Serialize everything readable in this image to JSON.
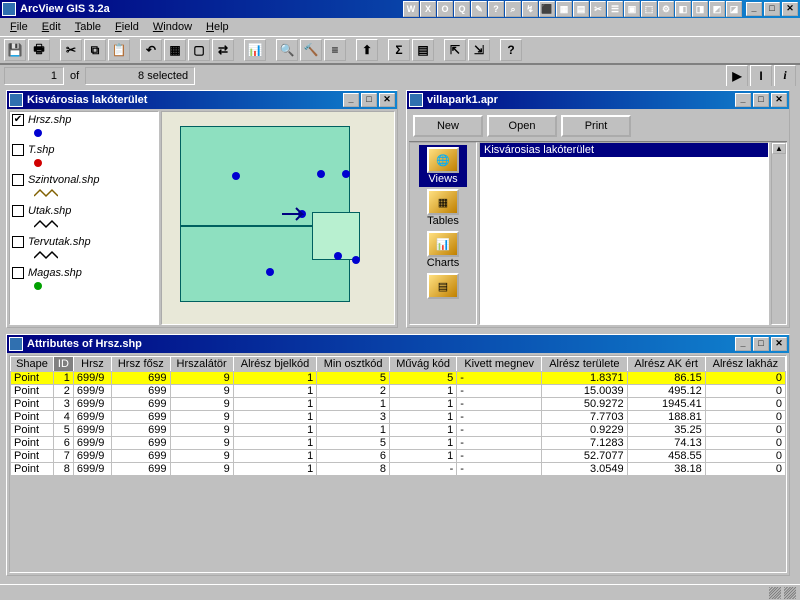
{
  "app": {
    "title": "ArcView GIS 3.2a"
  },
  "menu": [
    "File",
    "Edit",
    "Table",
    "Field",
    "Window",
    "Help"
  ],
  "status": {
    "count": "1",
    "of": "of",
    "selected": "8 selected"
  },
  "windows": {
    "view": {
      "title": "Kisvárosias lakóterület",
      "layers": [
        {
          "name": "Hrsz.shp",
          "checked": true,
          "sym": "point",
          "color": "#0000d0"
        },
        {
          "name": "T.shp",
          "checked": false,
          "sym": "point",
          "color": "#d00000"
        },
        {
          "name": "Szintvonal.shp",
          "checked": false,
          "sym": "line",
          "color": "#806000"
        },
        {
          "name": "Utak.shp",
          "checked": false,
          "sym": "zigzag",
          "color": "#000"
        },
        {
          "name": "Tervutak.shp",
          "checked": false,
          "sym": "zigzag",
          "color": "#000"
        },
        {
          "name": "Magas.shp",
          "checked": false,
          "sym": "point",
          "color": "#00a000"
        }
      ]
    },
    "project": {
      "title": "villapark1.apr",
      "buttons": [
        "New",
        "Open",
        "Print"
      ],
      "categories": [
        "Views",
        "Tables",
        "Charts"
      ],
      "selectedCat": 0,
      "items": [
        "Kisvárosias lakóterület"
      ]
    },
    "table": {
      "title": "Attributes of Hrsz.shp",
      "columns": [
        "Shape",
        "ID",
        "Hrsz",
        "Hrsz fősz",
        "Hrszalátör",
        "Alrész bjelkód",
        "Min osztkód",
        "Művág kód",
        "Kivett megnev",
        "Alrész területe",
        "Alrész AK ért",
        "Alrész lakház"
      ],
      "selectedCol": 1,
      "selectedRow": 0,
      "rows": [
        [
          "Point",
          "1",
          "699/9",
          "699",
          "9",
          "1",
          "5",
          "5",
          "-",
          "1.8371",
          "86.15",
          "0"
        ],
        [
          "Point",
          "2",
          "699/9",
          "699",
          "9",
          "1",
          "2",
          "1",
          "-",
          "15.0039",
          "495.12",
          "0"
        ],
        [
          "Point",
          "3",
          "699/9",
          "699",
          "9",
          "1",
          "1",
          "1",
          "-",
          "50.9272",
          "1945.41",
          "0"
        ],
        [
          "Point",
          "4",
          "699/9",
          "699",
          "9",
          "1",
          "3",
          "1",
          "-",
          "7.7703",
          "188.81",
          "0"
        ],
        [
          "Point",
          "5",
          "699/9",
          "699",
          "9",
          "1",
          "1",
          "1",
          "-",
          "0.9229",
          "35.25",
          "0"
        ],
        [
          "Point",
          "6",
          "699/9",
          "699",
          "9",
          "1",
          "5",
          "1",
          "-",
          "7.1283",
          "74.13",
          "0"
        ],
        [
          "Point",
          "7",
          "699/9",
          "699",
          "9",
          "1",
          "6",
          "1",
          "-",
          "52.7077",
          "458.55",
          "0"
        ],
        [
          "Point",
          "8",
          "699/9",
          "699",
          "9",
          "1",
          "8",
          "-",
          "-",
          "3.0549",
          "38.18",
          "0"
        ]
      ]
    }
  },
  "tray_icons": [
    "W",
    "X",
    "O",
    "Q",
    "✎",
    "?",
    "⌕",
    "↯",
    "⬛",
    "▦",
    "▤",
    "✂",
    "☰",
    "▣",
    "⬚",
    "⚙",
    "◧",
    "◨",
    "◩",
    "◪"
  ]
}
